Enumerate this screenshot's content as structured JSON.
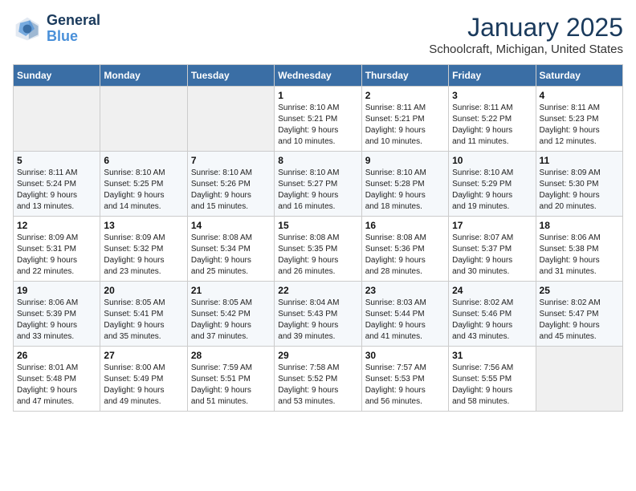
{
  "logo": {
    "line1": "General",
    "line2": "Blue"
  },
  "title": "January 2025",
  "subtitle": "Schoolcraft, Michigan, United States",
  "header": {
    "days": [
      "Sunday",
      "Monday",
      "Tuesday",
      "Wednesday",
      "Thursday",
      "Friday",
      "Saturday"
    ]
  },
  "weeks": [
    {
      "days": [
        {
          "num": "",
          "detail": ""
        },
        {
          "num": "",
          "detail": ""
        },
        {
          "num": "",
          "detail": ""
        },
        {
          "num": "1",
          "detail": "Sunrise: 8:10 AM\nSunset: 5:21 PM\nDaylight: 9 hours\nand 10 minutes."
        },
        {
          "num": "2",
          "detail": "Sunrise: 8:11 AM\nSunset: 5:21 PM\nDaylight: 9 hours\nand 10 minutes."
        },
        {
          "num": "3",
          "detail": "Sunrise: 8:11 AM\nSunset: 5:22 PM\nDaylight: 9 hours\nand 11 minutes."
        },
        {
          "num": "4",
          "detail": "Sunrise: 8:11 AM\nSunset: 5:23 PM\nDaylight: 9 hours\nand 12 minutes."
        }
      ]
    },
    {
      "days": [
        {
          "num": "5",
          "detail": "Sunrise: 8:11 AM\nSunset: 5:24 PM\nDaylight: 9 hours\nand 13 minutes."
        },
        {
          "num": "6",
          "detail": "Sunrise: 8:10 AM\nSunset: 5:25 PM\nDaylight: 9 hours\nand 14 minutes."
        },
        {
          "num": "7",
          "detail": "Sunrise: 8:10 AM\nSunset: 5:26 PM\nDaylight: 9 hours\nand 15 minutes."
        },
        {
          "num": "8",
          "detail": "Sunrise: 8:10 AM\nSunset: 5:27 PM\nDaylight: 9 hours\nand 16 minutes."
        },
        {
          "num": "9",
          "detail": "Sunrise: 8:10 AM\nSunset: 5:28 PM\nDaylight: 9 hours\nand 18 minutes."
        },
        {
          "num": "10",
          "detail": "Sunrise: 8:10 AM\nSunset: 5:29 PM\nDaylight: 9 hours\nand 19 minutes."
        },
        {
          "num": "11",
          "detail": "Sunrise: 8:09 AM\nSunset: 5:30 PM\nDaylight: 9 hours\nand 20 minutes."
        }
      ]
    },
    {
      "days": [
        {
          "num": "12",
          "detail": "Sunrise: 8:09 AM\nSunset: 5:31 PM\nDaylight: 9 hours\nand 22 minutes."
        },
        {
          "num": "13",
          "detail": "Sunrise: 8:09 AM\nSunset: 5:32 PM\nDaylight: 9 hours\nand 23 minutes."
        },
        {
          "num": "14",
          "detail": "Sunrise: 8:08 AM\nSunset: 5:34 PM\nDaylight: 9 hours\nand 25 minutes."
        },
        {
          "num": "15",
          "detail": "Sunrise: 8:08 AM\nSunset: 5:35 PM\nDaylight: 9 hours\nand 26 minutes."
        },
        {
          "num": "16",
          "detail": "Sunrise: 8:08 AM\nSunset: 5:36 PM\nDaylight: 9 hours\nand 28 minutes."
        },
        {
          "num": "17",
          "detail": "Sunrise: 8:07 AM\nSunset: 5:37 PM\nDaylight: 9 hours\nand 30 minutes."
        },
        {
          "num": "18",
          "detail": "Sunrise: 8:06 AM\nSunset: 5:38 PM\nDaylight: 9 hours\nand 31 minutes."
        }
      ]
    },
    {
      "days": [
        {
          "num": "19",
          "detail": "Sunrise: 8:06 AM\nSunset: 5:39 PM\nDaylight: 9 hours\nand 33 minutes."
        },
        {
          "num": "20",
          "detail": "Sunrise: 8:05 AM\nSunset: 5:41 PM\nDaylight: 9 hours\nand 35 minutes."
        },
        {
          "num": "21",
          "detail": "Sunrise: 8:05 AM\nSunset: 5:42 PM\nDaylight: 9 hours\nand 37 minutes."
        },
        {
          "num": "22",
          "detail": "Sunrise: 8:04 AM\nSunset: 5:43 PM\nDaylight: 9 hours\nand 39 minutes."
        },
        {
          "num": "23",
          "detail": "Sunrise: 8:03 AM\nSunset: 5:44 PM\nDaylight: 9 hours\nand 41 minutes."
        },
        {
          "num": "24",
          "detail": "Sunrise: 8:02 AM\nSunset: 5:46 PM\nDaylight: 9 hours\nand 43 minutes."
        },
        {
          "num": "25",
          "detail": "Sunrise: 8:02 AM\nSunset: 5:47 PM\nDaylight: 9 hours\nand 45 minutes."
        }
      ]
    },
    {
      "days": [
        {
          "num": "26",
          "detail": "Sunrise: 8:01 AM\nSunset: 5:48 PM\nDaylight: 9 hours\nand 47 minutes."
        },
        {
          "num": "27",
          "detail": "Sunrise: 8:00 AM\nSunset: 5:49 PM\nDaylight: 9 hours\nand 49 minutes."
        },
        {
          "num": "28",
          "detail": "Sunrise: 7:59 AM\nSunset: 5:51 PM\nDaylight: 9 hours\nand 51 minutes."
        },
        {
          "num": "29",
          "detail": "Sunrise: 7:58 AM\nSunset: 5:52 PM\nDaylight: 9 hours\nand 53 minutes."
        },
        {
          "num": "30",
          "detail": "Sunrise: 7:57 AM\nSunset: 5:53 PM\nDaylight: 9 hours\nand 56 minutes."
        },
        {
          "num": "31",
          "detail": "Sunrise: 7:56 AM\nSunset: 5:55 PM\nDaylight: 9 hours\nand 58 minutes."
        },
        {
          "num": "",
          "detail": ""
        }
      ]
    }
  ]
}
